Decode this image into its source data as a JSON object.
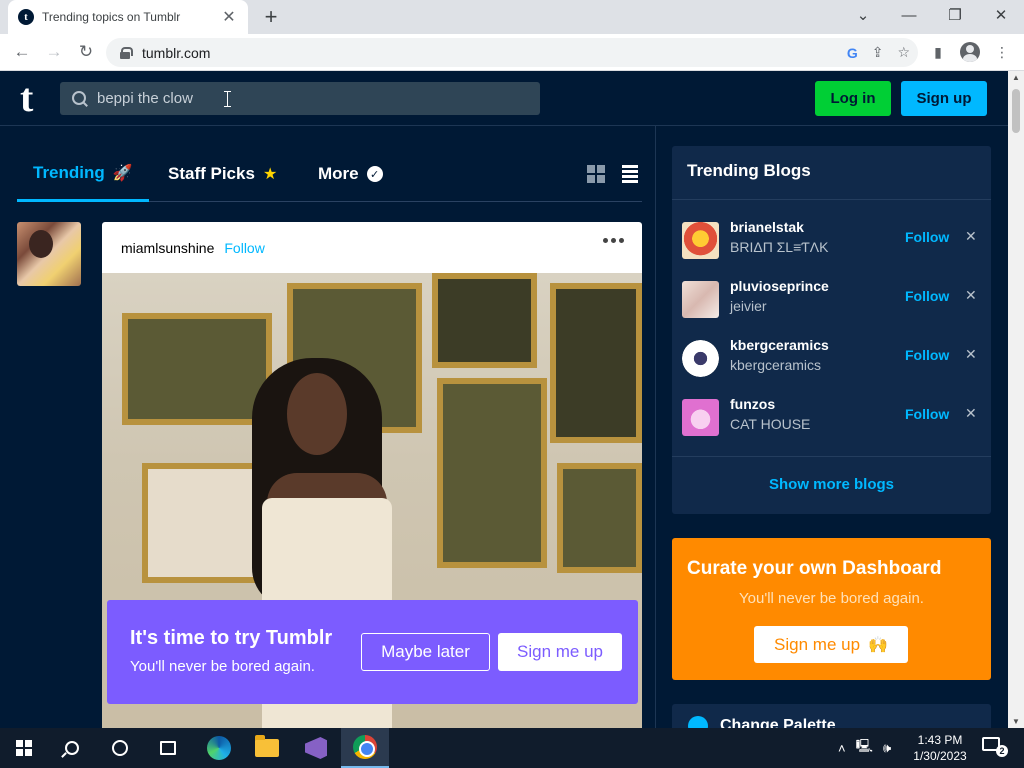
{
  "browser": {
    "tab_title": "Trending topics on Tumblr",
    "tab_favicon": "t",
    "tab_close": "✕",
    "new_tab": "+",
    "url": "tumblr.com",
    "window_controls": {
      "minimize": "—",
      "restore": "❐",
      "close": "✕",
      "tab_search": "⌄"
    }
  },
  "header": {
    "logo": "t",
    "search_value": "beppi the clow",
    "login_label": "Log in",
    "signup_label": "Sign up"
  },
  "nav": {
    "tabs": [
      {
        "label": "Trending",
        "icon": "🚀",
        "active": true
      },
      {
        "label": "Staff Picks",
        "icon": "★",
        "active": false
      },
      {
        "label": "More",
        "icon": "✓",
        "active": false
      }
    ]
  },
  "post": {
    "author": "miamlsunshine",
    "follow_label": "Follow"
  },
  "promo": {
    "title": "It's time to try Tumblr",
    "subtitle": "You'll never be bored again.",
    "maybe_label": "Maybe later",
    "signup_label": "Sign me up"
  },
  "trending_blogs": {
    "title": "Trending Blogs",
    "follow_label": "Follow",
    "dismiss": "✕",
    "blogs": [
      {
        "name": "brianelstak",
        "title": "BRIΔП ΣL≡ƬΛK"
      },
      {
        "name": "pluvioseprince",
        "title": "jeivier"
      },
      {
        "name": "kbergceramics",
        "title": "kbergceramics"
      },
      {
        "name": "funzos",
        "title": "CAT HOUSE"
      }
    ],
    "show_more_label": "Show more blogs"
  },
  "dashboard_card": {
    "title": "Curate your own Dashboard",
    "subtitle": "You'll never be bored again.",
    "button_label": "Sign me up",
    "button_icon": "🙌"
  },
  "palette": {
    "label": "Change Palette"
  },
  "taskbar": {
    "time": "1:43 PM",
    "date": "1/30/2023",
    "notification_count": "2"
  },
  "colors": {
    "tumblr_navy": "#001935",
    "accent_blue": "#00b8ff",
    "login_green": "#00cf35",
    "promo_purple": "#7c5cff",
    "dashboard_orange": "#ff8a00"
  }
}
